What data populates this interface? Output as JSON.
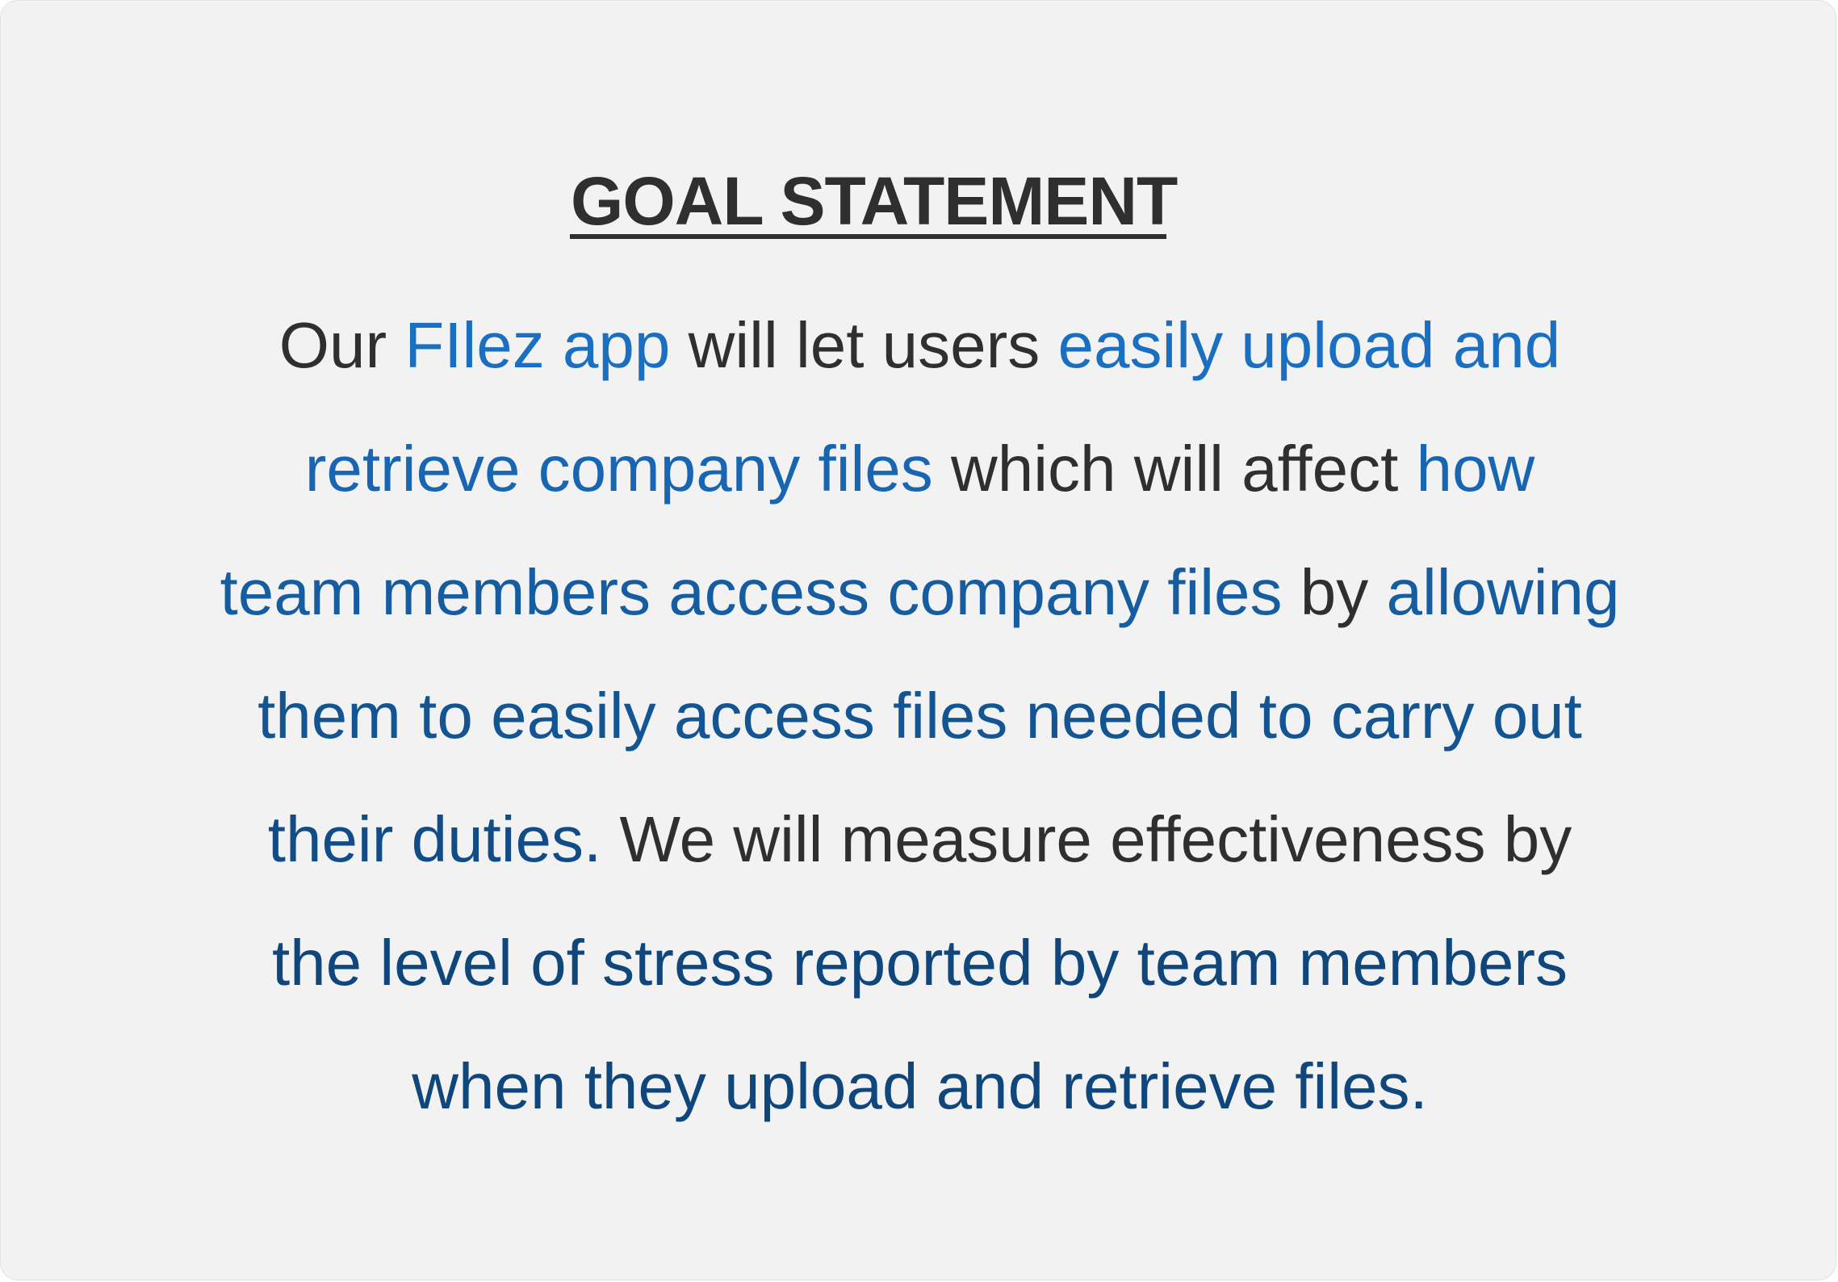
{
  "title": "GOAL STATEMENT",
  "colors": {
    "background": "#f2f2f2",
    "text": "#2f2f2f",
    "highlight_1": "#1a6fc0",
    "highlight_2": "#1866b2",
    "highlight_3": "#155ca0",
    "highlight_4": "#135593",
    "highlight_5": "#114c86",
    "highlight_6": "#0f467c"
  },
  "statement": {
    "lines": [
      [
        {
          "text": "Our ",
          "highlight": false
        },
        {
          "text": "FIlez app",
          "highlight": true,
          "color": "#1a6fc0"
        },
        {
          "text": " will let users ",
          "highlight": false
        },
        {
          "text": "easily upload and",
          "highlight": true,
          "color": "#1a6fc0"
        }
      ],
      [
        {
          "text": "retrieve company files",
          "highlight": true,
          "color": "#1866b2"
        },
        {
          "text": " which will affect ",
          "highlight": false
        },
        {
          "text": "how",
          "highlight": true,
          "color": "#1866b2"
        }
      ],
      [
        {
          "text": "team members access company files",
          "highlight": true,
          "color": "#155ca0"
        },
        {
          "text": " by ",
          "highlight": false
        },
        {
          "text": "allowing",
          "highlight": true,
          "color": "#155ca0"
        }
      ],
      [
        {
          "text": "them to easily access files needed to carry out",
          "highlight": true,
          "color": "#135593"
        }
      ],
      [
        {
          "text": "their duties.",
          "highlight": true,
          "color": "#114c86"
        },
        {
          "text": " We will measure effectiveness by",
          "highlight": false
        }
      ],
      [
        {
          "text": "the level of stress reported by team members",
          "highlight": true,
          "color": "#0f467c"
        }
      ],
      [
        {
          "text": "when they upload and retrieve files.",
          "highlight": true,
          "color": "#0f467c"
        }
      ]
    ]
  }
}
